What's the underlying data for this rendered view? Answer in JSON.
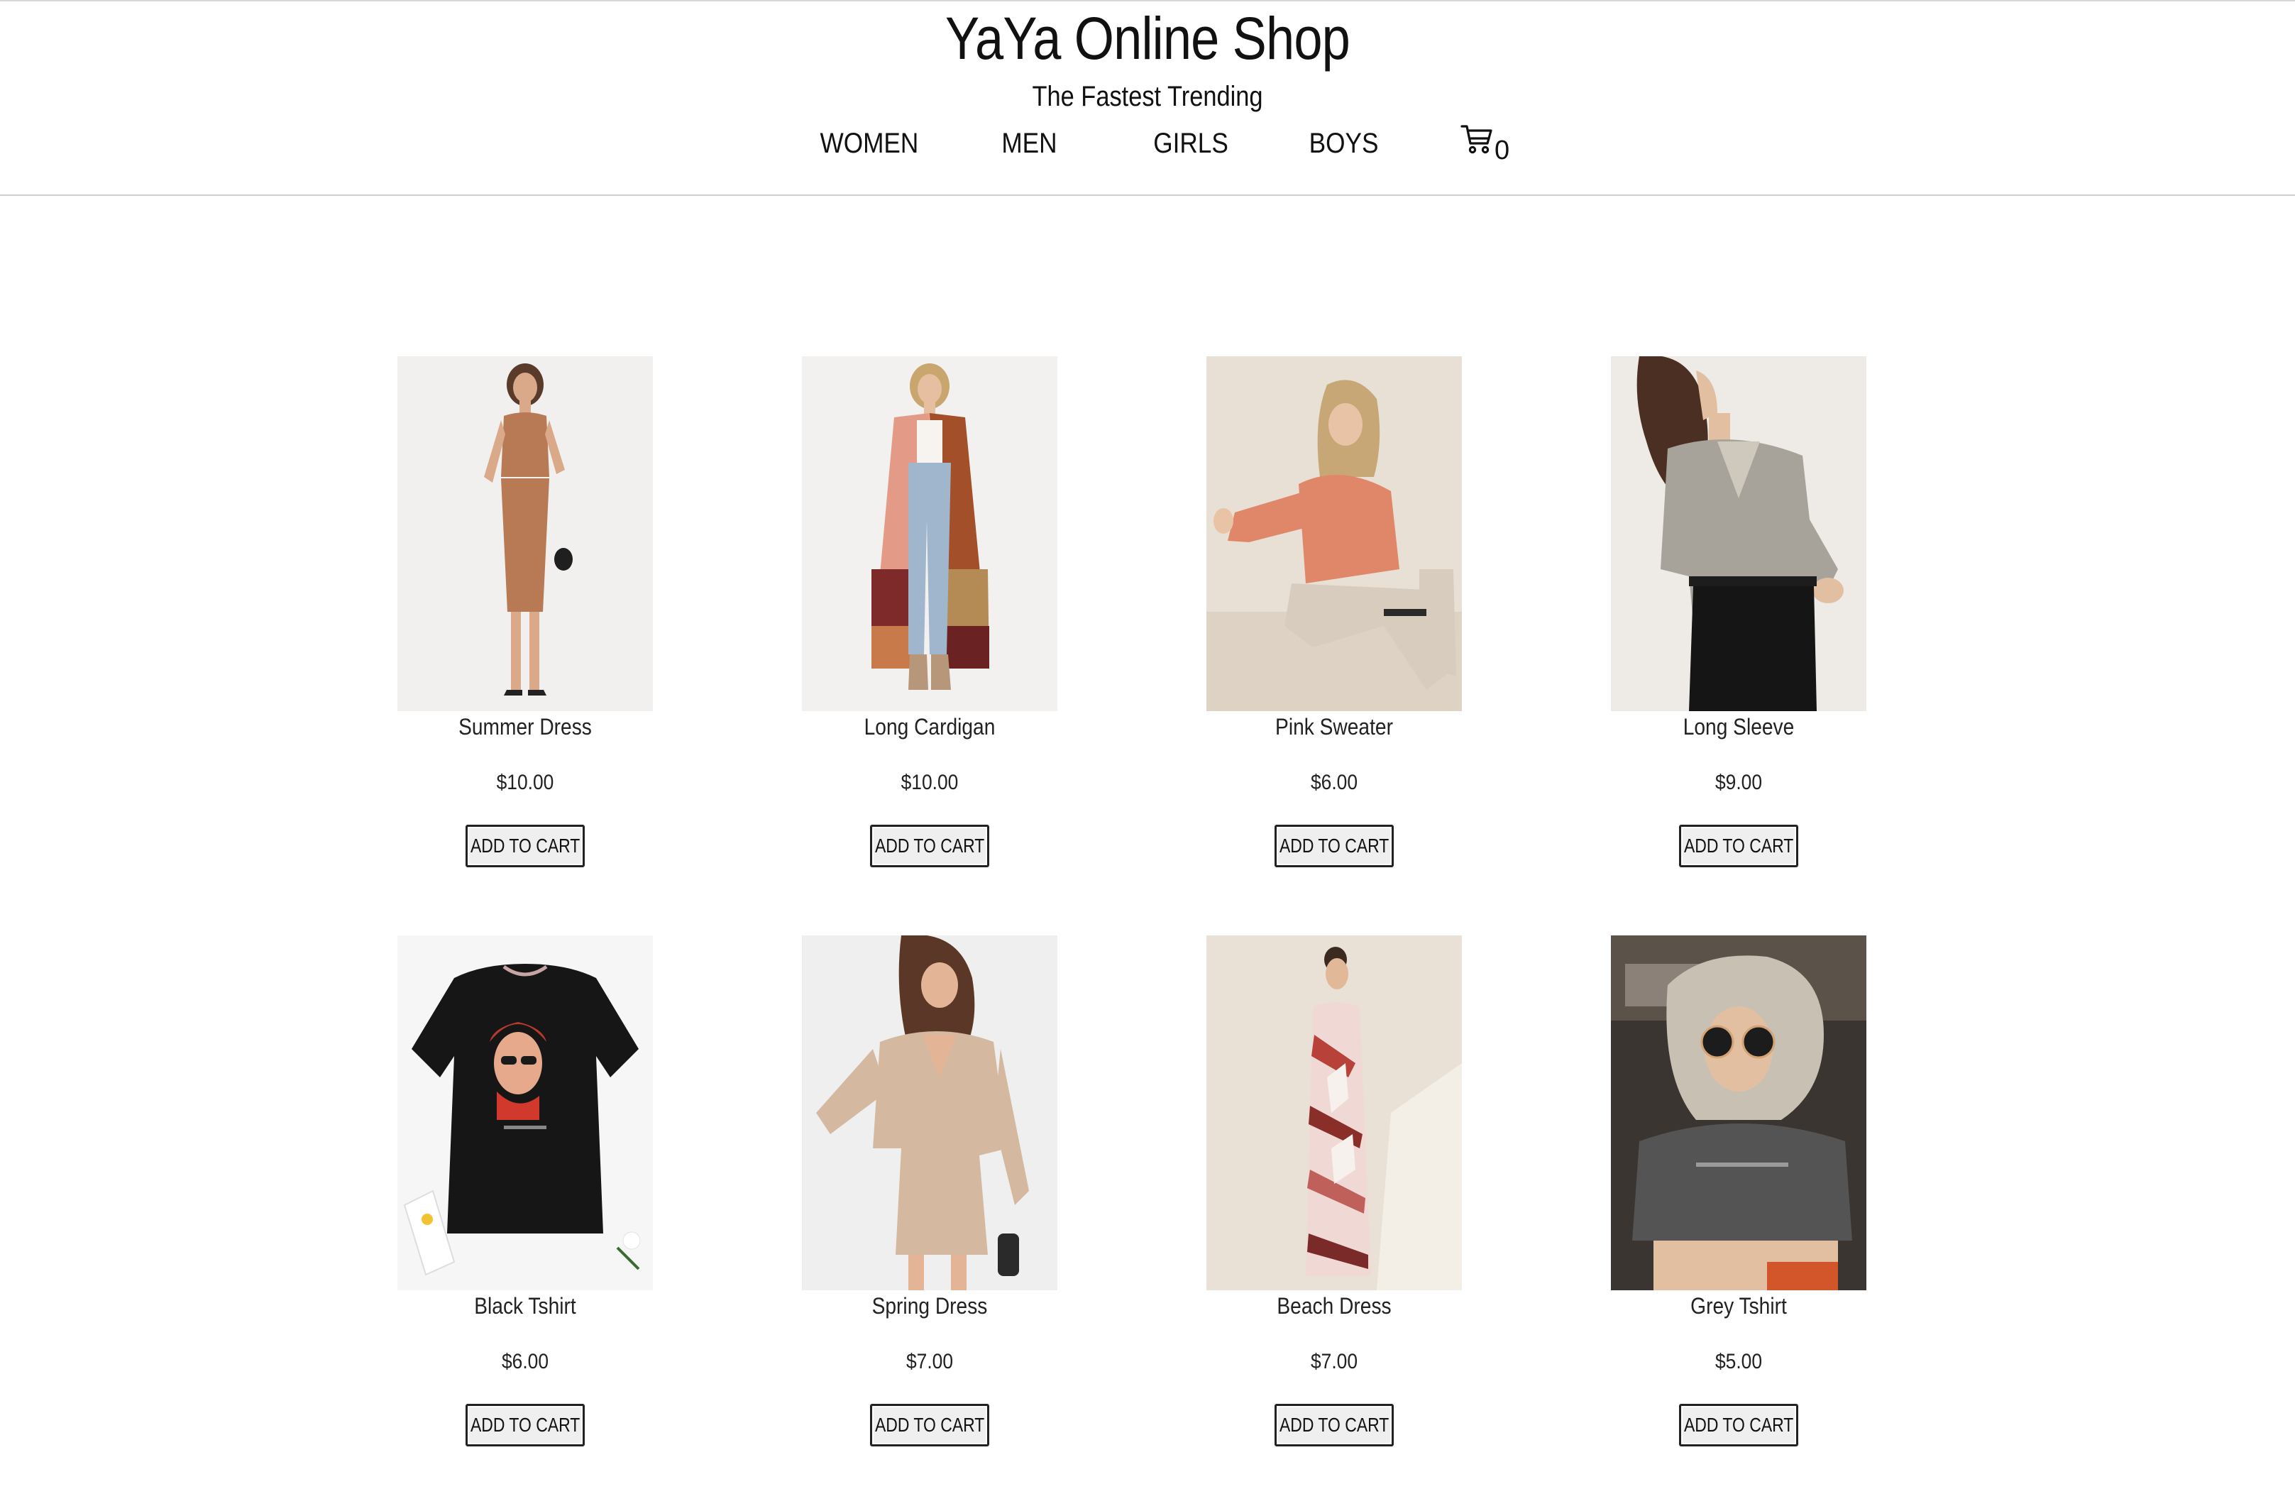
{
  "header": {
    "title": "YaYa Online Shop",
    "tagline": "The Fastest Trending",
    "nav": [
      {
        "label": "WOMEN"
      },
      {
        "label": "MEN"
      },
      {
        "label": "GIRLS"
      },
      {
        "label": "BOYS"
      }
    ],
    "cart": {
      "icon": "cart-icon",
      "count": "0"
    }
  },
  "products": [
    {
      "name": "Summer Dress",
      "price": "$10.00",
      "button": "ADD TO CART"
    },
    {
      "name": "Long Cardigan",
      "price": "$10.00",
      "button": "ADD TO CART"
    },
    {
      "name": "Pink Sweater",
      "price": "$6.00",
      "button": "ADD TO CART"
    },
    {
      "name": "Long Sleeve",
      "price": "$9.00",
      "button": "ADD TO CART"
    },
    {
      "name": "Black Tshirt",
      "price": "$6.00",
      "button": "ADD TO CART"
    },
    {
      "name": "Spring Dress",
      "price": "$7.00",
      "button": "ADD TO CART"
    },
    {
      "name": "Beach Dress",
      "price": "$7.00",
      "button": "ADD TO CART"
    },
    {
      "name": "Grey Tshirt",
      "price": "$5.00",
      "button": "ADD TO CART"
    }
  ]
}
